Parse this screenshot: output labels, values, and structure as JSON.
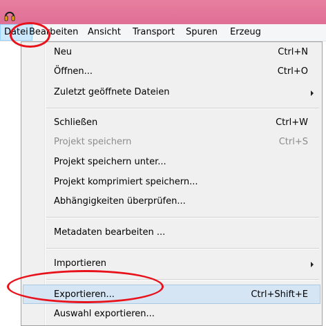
{
  "menubar": {
    "items": [
      "Datei",
      "Bearbeiten",
      "Ansicht",
      "Transport",
      "Spuren",
      "Erzeug"
    ]
  },
  "menu": {
    "items": [
      {
        "label": "Neu",
        "shortcut": "Ctrl+N"
      },
      {
        "label": "Öffnen...",
        "shortcut": "Ctrl+O"
      },
      {
        "label": "Zuletzt geöffnete Dateien",
        "submenu": true
      },
      {
        "label": "Schließen",
        "shortcut": "Ctrl+W"
      },
      {
        "label": "Projekt speichern",
        "shortcut": "Ctrl+S",
        "disabled": true
      },
      {
        "label": "Projekt speichern unter..."
      },
      {
        "label": "Projekt komprimiert speichern..."
      },
      {
        "label": "Abhängigkeiten überprüfen..."
      },
      {
        "label": "Metadaten bearbeiten ..."
      },
      {
        "label": "Importieren",
        "submenu": true
      },
      {
        "label": "Exportieren...",
        "shortcut": "Ctrl+Shift+E",
        "highlighted": true
      },
      {
        "label": "Auswahl exportieren..."
      }
    ]
  },
  "colors": {
    "titlebar": "#e07096",
    "highlight": "#d5e5f4",
    "annotation": "#e8121b"
  }
}
